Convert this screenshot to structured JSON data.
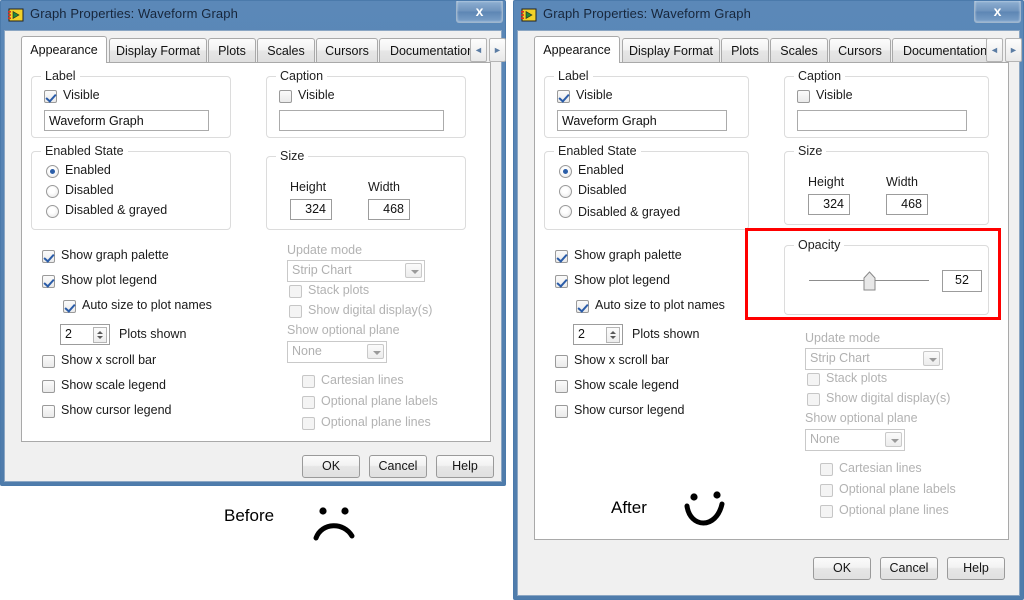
{
  "before_window": {
    "title": "Graph Properties: Waveform Graph",
    "close_label": "x",
    "app_icon": "labview-icon",
    "tabs": [
      {
        "label": "Appearance",
        "active": true
      },
      {
        "label": "Display Format",
        "active": false
      },
      {
        "label": "Plots",
        "active": false
      },
      {
        "label": "Scales",
        "active": false
      },
      {
        "label": "Cursors",
        "active": false
      },
      {
        "label": "Documentation",
        "active": false
      }
    ],
    "tab_nav_prev": "◄",
    "tab_nav_next": "►",
    "label_group": {
      "title": "Label",
      "visible_label": "Visible",
      "visible_checked": true,
      "text_value": "Waveform Graph"
    },
    "caption_group": {
      "title": "Caption",
      "visible_label": "Visible",
      "visible_checked": false,
      "text_value": ""
    },
    "enabled_state_group": {
      "title": "Enabled State",
      "options": [
        "Enabled",
        "Disabled",
        "Disabled & grayed"
      ],
      "selected": "Enabled"
    },
    "size_group": {
      "title": "Size",
      "height_label": "Height",
      "height_value": "324",
      "width_label": "Width",
      "width_value": "468"
    },
    "checkboxes": [
      {
        "label": "Show graph palette",
        "checked": true,
        "indent": 0
      },
      {
        "label": "Show plot legend",
        "checked": true,
        "indent": 0
      },
      {
        "label": "Auto size to plot names",
        "checked": true,
        "indent": 1
      }
    ],
    "plots_shown": {
      "value": "2",
      "label": "Plots shown"
    },
    "checkboxes2": [
      {
        "label": "Show x scroll bar",
        "checked": false
      },
      {
        "label": "Show scale legend",
        "checked": false
      },
      {
        "label": "Show cursor legend",
        "checked": false
      }
    ],
    "update_mode": {
      "label": "Update mode",
      "value": "Strip Chart",
      "disabled": true
    },
    "disabled_checks": [
      {
        "label": "Stack plots",
        "checked": false
      },
      {
        "label": "Show digital display(s)",
        "checked": false
      }
    ],
    "optional_plane": {
      "label": "Show optional plane",
      "value": "None",
      "disabled": true
    },
    "plane_checks": [
      {
        "label": "Cartesian lines",
        "checked": false
      },
      {
        "label": "Optional plane labels",
        "checked": false
      },
      {
        "label": "Optional plane lines",
        "checked": false
      }
    ],
    "buttons": [
      {
        "label": "OK"
      },
      {
        "label": "Cancel"
      },
      {
        "label": "Help"
      }
    ]
  },
  "after_window": {
    "title": "Graph Properties: Waveform Graph",
    "close_label": "x",
    "app_icon": "labview-icon",
    "tabs": [
      {
        "label": "Appearance",
        "active": true
      },
      {
        "label": "Display Format",
        "active": false
      },
      {
        "label": "Plots",
        "active": false
      },
      {
        "label": "Scales",
        "active": false
      },
      {
        "label": "Cursors",
        "active": false
      },
      {
        "label": "Documentation",
        "active": false
      }
    ],
    "tab_nav_prev": "◄",
    "tab_nav_next": "►",
    "label_group": {
      "title": "Label",
      "visible_label": "Visible",
      "visible_checked": true,
      "text_value": "Waveform Graph"
    },
    "caption_group": {
      "title": "Caption",
      "visible_label": "Visible",
      "visible_checked": false,
      "text_value": ""
    },
    "enabled_state_group": {
      "title": "Enabled State",
      "options": [
        "Enabled",
        "Disabled",
        "Disabled & grayed"
      ],
      "selected": "Enabled"
    },
    "size_group": {
      "title": "Size",
      "height_label": "Height",
      "height_value": "324",
      "width_label": "Width",
      "width_value": "468"
    },
    "opacity_group": {
      "title": "Opacity",
      "value": "52",
      "slider_percent": 52,
      "highlighted": true,
      "highlight_color": "#ff0000"
    },
    "checkboxes": [
      {
        "label": "Show graph palette",
        "checked": true,
        "indent": 0
      },
      {
        "label": "Show plot legend",
        "checked": true,
        "indent": 0
      },
      {
        "label": "Auto size to plot names",
        "checked": true,
        "indent": 1
      }
    ],
    "plots_shown": {
      "value": "2",
      "label": "Plots shown"
    },
    "checkboxes2": [
      {
        "label": "Show x scroll bar",
        "checked": false
      },
      {
        "label": "Show scale legend",
        "checked": false
      },
      {
        "label": "Show cursor legend",
        "checked": false
      }
    ],
    "update_mode": {
      "label": "Update mode",
      "value": "Strip Chart",
      "disabled": true
    },
    "disabled_checks": [
      {
        "label": "Stack plots",
        "checked": false
      },
      {
        "label": "Show digital display(s)",
        "checked": false
      }
    ],
    "optional_plane": {
      "label": "Show optional plane",
      "value": "None",
      "disabled": true
    },
    "plane_checks": [
      {
        "label": "Cartesian lines",
        "checked": false
      },
      {
        "label": "Optional plane labels",
        "checked": false
      },
      {
        "label": "Optional plane lines",
        "checked": false
      }
    ],
    "buttons": [
      {
        "label": "OK"
      },
      {
        "label": "Cancel"
      },
      {
        "label": "Help"
      }
    ]
  },
  "annotations": {
    "before_label": "Before",
    "before_face": "sad-face",
    "after_label": "After",
    "after_face": "happy-face"
  }
}
